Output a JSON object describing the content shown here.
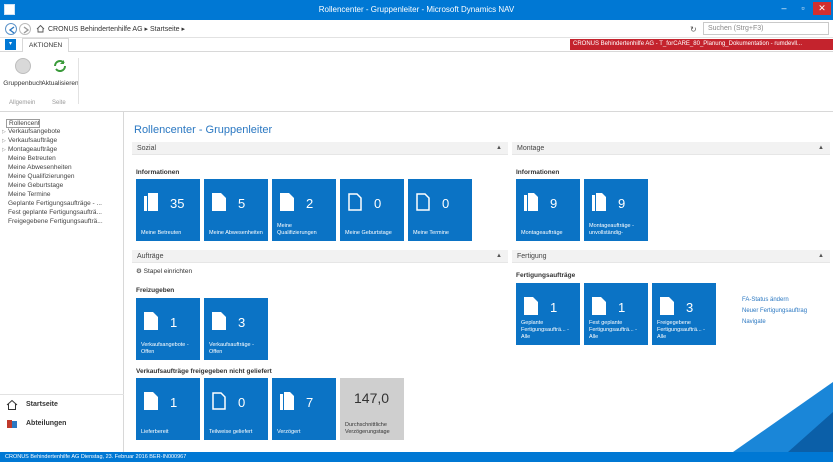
{
  "window": {
    "title": "Rollencenter - Gruppenleiter - Microsoft Dynamics NAV"
  },
  "address": {
    "breadcrumb_company": "CRONUS Behindertenhilfe AG",
    "breadcrumb_sep": "▸",
    "breadcrumb_page": "Startseite",
    "search_placeholder": "Suchen (Strg+F3)"
  },
  "ribbon": {
    "tab_label": "AKTIONEN",
    "company_banner": "CRONUS Behindertenhilfe AG - T_forCARE_80_Planung_Dokumentation - rumdevll...",
    "buttons": [
      {
        "label": "Gruppenbuch",
        "icon": "group-book-icon"
      },
      {
        "label": "Aktualisieren",
        "icon": "refresh-icon"
      }
    ],
    "groups": [
      "Allgemein",
      "Seite"
    ]
  },
  "nav": {
    "items": [
      {
        "label": "Rollencenter",
        "selected": true
      },
      {
        "label": "Verkaufsangebote",
        "arrow": true
      },
      {
        "label": "Verkaufsaufträge",
        "arrow": true
      },
      {
        "label": "Montageaufträge",
        "arrow": true
      },
      {
        "label": "Meine Betreuten"
      },
      {
        "label": "Meine Abwesenheiten"
      },
      {
        "label": "Meine Qualifizierungen"
      },
      {
        "label": "Meine Geburtstage"
      },
      {
        "label": "Meine Termine"
      },
      {
        "label": "Geplante Fertigungsaufträge - ..."
      },
      {
        "label": "Fest geplante Fertigungsaufträ..."
      },
      {
        "label": "Freigegebene Fertigungsaufträ..."
      }
    ],
    "bottom": [
      {
        "label": "Startseite",
        "icon": "home-icon"
      },
      {
        "label": "Abteilungen",
        "icon": "departments-icon"
      }
    ]
  },
  "main": {
    "page_title": "Rollencenter - Gruppenleiter",
    "sozial": {
      "header": "Sozial",
      "group": "Informationen",
      "tiles": [
        {
          "value": "35",
          "label": "Meine Betreuten"
        },
        {
          "value": "5",
          "label": "Meine Abwesenheiten"
        },
        {
          "value": "2",
          "label": "Meine Qualifizierungen"
        },
        {
          "value": "0",
          "label": "Meine Geburtstage"
        },
        {
          "value": "0",
          "label": "Meine Termine"
        }
      ]
    },
    "montage": {
      "header": "Montage",
      "group": "Informationen",
      "tiles": [
        {
          "value": "9",
          "label": "Montageaufträge"
        },
        {
          "value": "9",
          "label": "Montageaufträge -unvollständig-"
        }
      ]
    },
    "auftraege": {
      "header": "Aufträge",
      "action": "Stapel einrichten",
      "group_freizugeben": "Freizugeben",
      "tiles_freizugeben": [
        {
          "value": "1",
          "label": "Verkaufsangebote - Offen"
        },
        {
          "value": "3",
          "label": "Verkaufsaufträge - Offen"
        }
      ],
      "group_nicht_geliefert": "Verkaufsaufträge freigegeben nicht geliefert",
      "tiles_nicht_geliefert": [
        {
          "value": "1",
          "label": "Lieferbereit"
        },
        {
          "value": "0",
          "label": "Teilweise geliefert"
        },
        {
          "value": "7",
          "label": "Verzögert"
        },
        {
          "value": "147,0",
          "label": "Durchschnittliche Verzögerungstage"
        }
      ]
    },
    "fertigung": {
      "header": "Fertigung",
      "group": "Fertigungsaufträge",
      "tiles": [
        {
          "value": "1",
          "label": "Geplante Fertigungsaufträ... - Alle"
        },
        {
          "value": "1",
          "label": "Fest geplante Fertigungsaufträ... - Alle"
        },
        {
          "value": "3",
          "label": "Freigegebene Fertigungsaufträ... - Alle"
        }
      ],
      "links": [
        "FA-Status ändern",
        "Neuer Fertigungsauftrag",
        "Navigate"
      ]
    }
  },
  "status": {
    "text": "CRONUS Behindertenhilfe AG    Dienstag, 23. Februar 2016    BER-IN000967"
  },
  "colors": {
    "accent": "#0078d4",
    "tile": "#0b73c5",
    "banner": "#c4232d"
  }
}
